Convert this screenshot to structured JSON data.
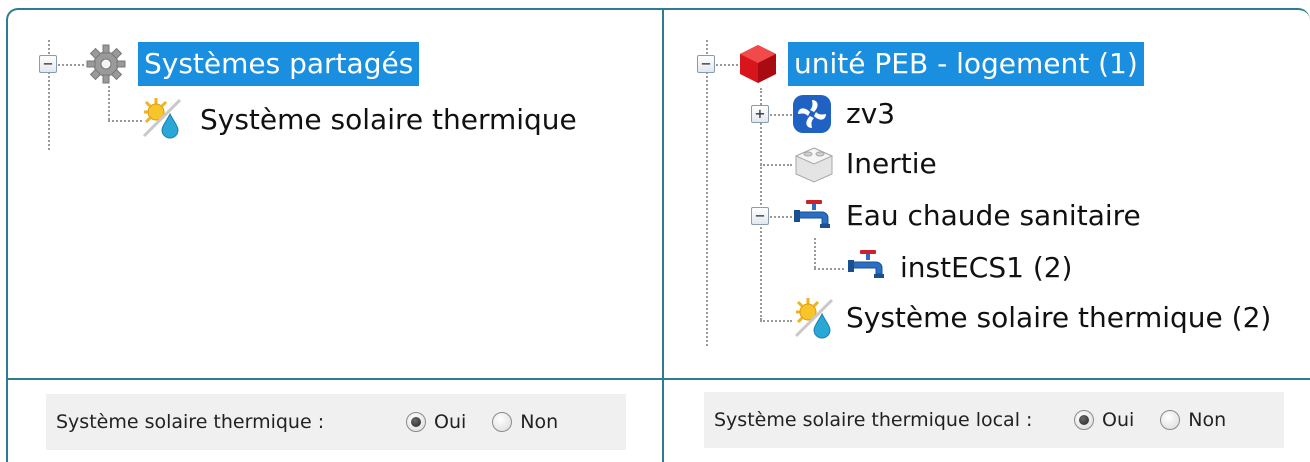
{
  "left_tree": {
    "root_label": "Systèmes partagés",
    "child_label": "Système solaire thermique"
  },
  "right_tree": {
    "root_label": "unité PEB - logement (1)",
    "items": [
      {
        "label": "zv3",
        "expander": "+",
        "icon": "ventilation-icon"
      },
      {
        "label": "Inertie",
        "icon": "inertia-block-icon"
      },
      {
        "label": "Eau chaude sanitaire",
        "expander": "−",
        "icon": "faucet-icon"
      },
      {
        "label": "instECS1 (2)",
        "icon": "faucet-icon"
      },
      {
        "label": "Système solaire thermique (2)",
        "icon": "solar-thermal-icon"
      }
    ]
  },
  "left_panel": {
    "question": "Système solaire thermique  :",
    "yes": "Oui",
    "no": "Non",
    "selected": "Oui"
  },
  "right_panel": {
    "question": "Système solaire thermique local :",
    "yes": "Oui",
    "no": "Non",
    "selected": "Oui"
  },
  "colors": {
    "border": "#2e7d8e",
    "selection": "#1a8fe0"
  }
}
